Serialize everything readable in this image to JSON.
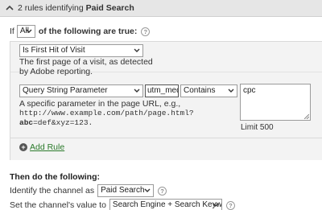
{
  "header": {
    "count_text": "2 rules identifying ",
    "channel_name": "Paid Search"
  },
  "conditions": {
    "if_label": "If",
    "match_value": "All",
    "following_text": "of the following are true:"
  },
  "rules": [
    {
      "type_value": "Is First Hit of Visit",
      "description": "The first page of a visit, as detected by Adobe reporting."
    },
    {
      "type_value": "Query String Parameter",
      "param_value": "utm_mediur",
      "operator_value": "Contains",
      "values_text": "cpc",
      "desc_line1": "A specific parameter in the page URL, e.g.,",
      "desc_url_pre": "http://www.example.com/path/page.html?",
      "desc_url_bold": "abc",
      "desc_url_post": "=def&xyz=123.",
      "limit_text": "Limit 500"
    }
  ],
  "add_rule_label": "Add Rule",
  "then": {
    "heading": "Then do the following:",
    "identify_label": "Identify the channel as",
    "channel_value": "Paid Search",
    "set_value_label": "Set the channel's value to",
    "set_value_value": "Search Engine + Search Keyword(s)"
  },
  "icons": {
    "help_glyph": "?"
  }
}
